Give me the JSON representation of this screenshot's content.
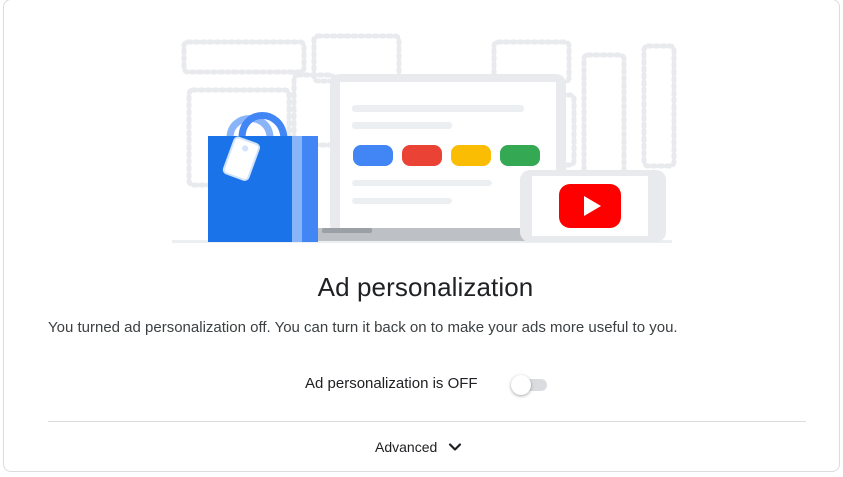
{
  "heading": "Ad personalization",
  "description": "You turned ad personalization off. You can turn it back on to make your ads more useful to you.",
  "toggle": {
    "label": "Ad personalization is OFF",
    "state": "off"
  },
  "advanced": {
    "label": "Advanced",
    "icon": "chevron-down-icon"
  },
  "colors": {
    "blue": "#4285f4",
    "red": "#ea4335",
    "yellow": "#fbbc04",
    "green": "#34a853",
    "youtube_red": "#ff0000",
    "bag_blue": "#1a73e8"
  }
}
